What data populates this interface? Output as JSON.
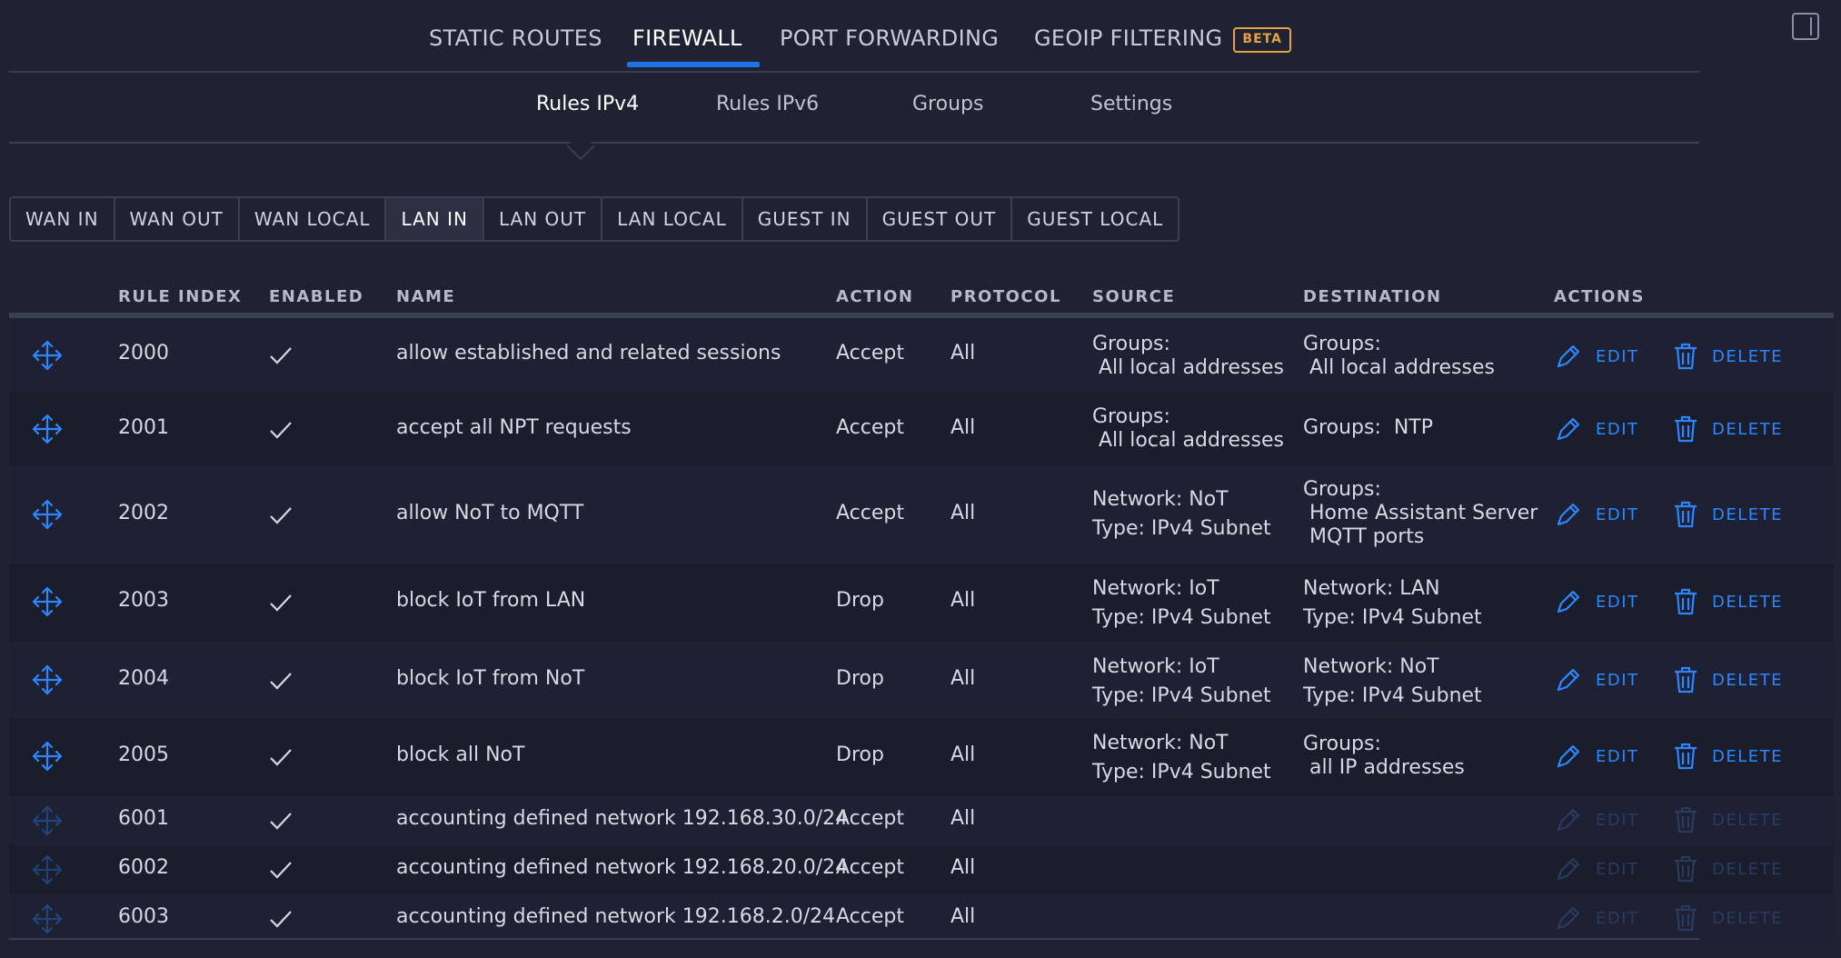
{
  "top_tabs": [
    {
      "label": "STATIC ROUTES"
    },
    {
      "label": "FIREWALL"
    },
    {
      "label": "PORT FORWARDING"
    },
    {
      "label": "GEOIP FILTERING",
      "badge": "BETA"
    }
  ],
  "sub_tabs": [
    {
      "label": "Rules IPv4"
    },
    {
      "label": "Rules IPv6"
    },
    {
      "label": "Groups"
    },
    {
      "label": "Settings"
    }
  ],
  "filter_tabs": [
    "WAN IN",
    "WAN OUT",
    "WAN LOCAL",
    "LAN IN",
    "LAN OUT",
    "LAN LOCAL",
    "GUEST IN",
    "GUEST OUT",
    "GUEST LOCAL"
  ],
  "active_filter": "LAN IN",
  "table": {
    "headers": {
      "rule_index": "RULE INDEX",
      "enabled": "ENABLED",
      "name": "NAME",
      "action": "ACTION",
      "protocol": "PROTOCOL",
      "source": "SOURCE",
      "destination": "DESTINATION",
      "actions": "ACTIONS"
    },
    "edit_label": "EDIT",
    "delete_label": "DELETE",
    "rows": [
      {
        "index": "2000",
        "name": "allow established and related sessions",
        "action": "Accept",
        "protocol": "All",
        "source": [
          "Groups:",
          " All local addresses"
        ],
        "destination": [
          "Groups:",
          " All local addresses"
        ]
      },
      {
        "index": "2001",
        "name": "accept all NPT requests",
        "action": "Accept",
        "protocol": "All",
        "source": [
          "Groups:",
          " All local addresses"
        ],
        "destination": [
          "Groups:  NTP"
        ]
      },
      {
        "index": "2002",
        "name": "allow NoT to MQTT",
        "action": "Accept",
        "protocol": "All",
        "source": [
          "Network: NoT",
          "Type: IPv4 Subnet"
        ],
        "destination": [
          "Groups:",
          " Home Assistant Server",
          " MQTT ports"
        ]
      },
      {
        "index": "2003",
        "name": "block IoT from LAN",
        "action": "Drop",
        "protocol": "All",
        "source": [
          "Network: IoT",
          "Type: IPv4 Subnet"
        ],
        "destination": [
          "Network: LAN",
          "Type: IPv4 Subnet"
        ]
      },
      {
        "index": "2004",
        "name": "block IoT from NoT",
        "action": "Drop",
        "protocol": "All",
        "source": [
          "Network: IoT",
          "Type: IPv4 Subnet"
        ],
        "destination": [
          "Network: NoT",
          "Type: IPv4 Subnet"
        ]
      },
      {
        "index": "2005",
        "name": "block all NoT",
        "action": "Drop",
        "protocol": "All",
        "source": [
          "Network: NoT",
          "Type: IPv4 Subnet"
        ],
        "destination": [
          "Groups:",
          " all IP addresses"
        ]
      },
      {
        "index": "6001",
        "name": "accounting defined network 192.168.30.0/24",
        "action": "Accept",
        "protocol": "All",
        "source": [],
        "destination": []
      },
      {
        "index": "6002",
        "name": "accounting defined network 192.168.20.0/24",
        "action": "Accept",
        "protocol": "All",
        "source": [],
        "destination": []
      },
      {
        "index": "6003",
        "name": "accounting defined network 192.168.2.0/24",
        "action": "Accept",
        "protocol": "All",
        "source": [],
        "destination": []
      }
    ]
  },
  "colors": {
    "accent": "#1f73e6",
    "link": "#2c86ff",
    "beta": "#e6a23c",
    "background": "#1f2233"
  }
}
